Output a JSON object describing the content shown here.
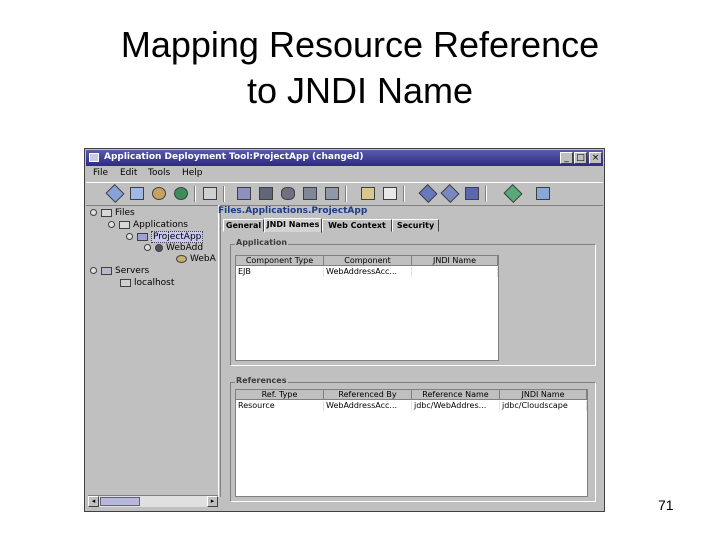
{
  "slide": {
    "title_line1": "Mapping Resource Reference",
    "title_line2": "to JNDI Name",
    "page_number": "71"
  },
  "window": {
    "title": "Application Deployment Tool:ProjectApp (changed)",
    "menu": [
      "File",
      "Edit",
      "Tools",
      "Help"
    ],
    "controls": {
      "minimize": "_",
      "maximize": "□",
      "close": "×"
    }
  },
  "tree": {
    "nodes": [
      {
        "label": "Files",
        "icon": "folder-icon"
      },
      {
        "label": "Applications",
        "icon": "folder-icon"
      },
      {
        "label": "ProjectApp",
        "icon": "application-icon",
        "selected": true
      },
      {
        "label": "WebAdd",
        "icon": "ejb-jar-icon"
      },
      {
        "label": "WebA",
        "icon": "bean-icon"
      },
      {
        "label": "Servers",
        "icon": "server-icon"
      },
      {
        "label": "localhost",
        "icon": "host-icon"
      }
    ]
  },
  "detail": {
    "path": "Files.Applications.ProjectApp",
    "tabs": [
      "General",
      "JNDI Names",
      "Web Context",
      "Security"
    ],
    "active_tab": "JNDI Names",
    "application_group": {
      "title": "Application",
      "columns": [
        "Component Type",
        "Component",
        "JNDI Name"
      ],
      "rows": [
        [
          "EJB",
          "WebAddressAcc...",
          ""
        ]
      ]
    },
    "references_group": {
      "title": "References",
      "columns": [
        "Ref. Type",
        "Referenced By",
        "Reference Name",
        "JNDI Name"
      ],
      "rows": [
        [
          "Resource",
          "WebAddressAcc...",
          "jdbc/WebAddres...",
          "jdbc/Cloudscape"
        ]
      ]
    }
  },
  "colors": {
    "titlebar": "#2a2a88",
    "window_bg": "#c0c0c0",
    "path_text": "#1c3c88"
  }
}
